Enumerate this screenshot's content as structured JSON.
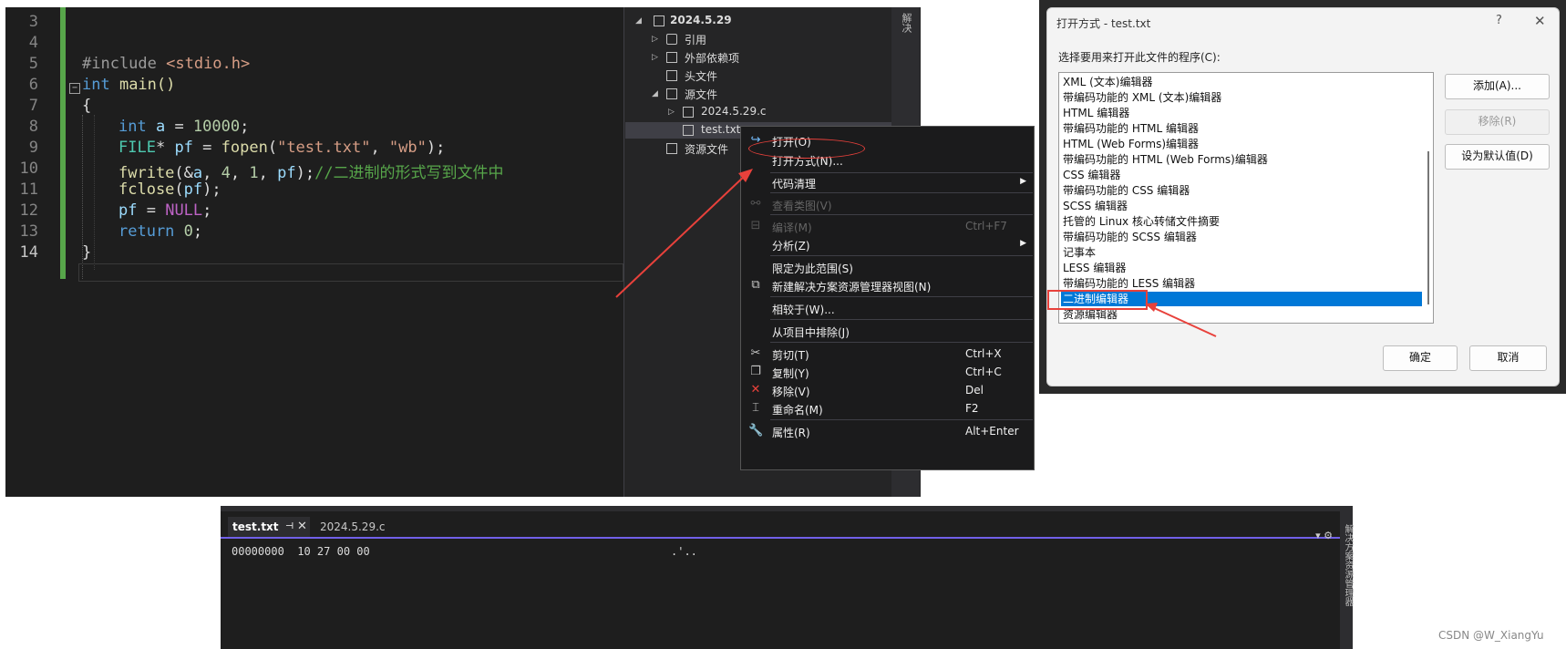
{
  "editor": {
    "line_numbers": [
      "3",
      "4",
      "5",
      "6",
      "7",
      "8",
      "9",
      "10",
      "11",
      "12",
      "13",
      "14"
    ],
    "fold_marker": "−",
    "code": {
      "include_kw": "#include",
      "include_hdr": " <stdio.h>",
      "int_kw": "int",
      "main_rest": " main()",
      "brace_open": "{",
      "l8_type": "int",
      "l8_var": " a",
      "l8_eq": " = ",
      "l8_num": "10000",
      "l8_semi": ";",
      "l9_type": "FILE",
      "l9_star": "*",
      "l9_var": " pf",
      "l9_eq": " = ",
      "l9_fn": "fopen",
      "l9_p1": "(",
      "l9_s1": "\"test.txt\"",
      "l9_c": ", ",
      "l9_s2": "\"wb\"",
      "l9_p2": ");",
      "l10_fn": "fwrite",
      "l10_p1": "(&",
      "l10_a": "a",
      "l10_c1": ", ",
      "l10_n1": "4",
      "l10_c2": ", ",
      "l10_n2": "1",
      "l10_c3": ", ",
      "l10_pf": "pf",
      "l10_p2": ");",
      "l10_comment": "//二进制的形式写到文件中",
      "l11_fn": "fclose",
      "l11_p1": "(",
      "l11_pf": "pf",
      "l11_p2": ");",
      "l12_pf": "pf",
      "l12_eq": " = ",
      "l12_null": "NULL",
      "l12_semi": ";",
      "l13_kw": "return",
      "l13_sp": " ",
      "l13_num": "0",
      "l13_semi": ";",
      "brace_close": "}"
    }
  },
  "explorer": {
    "items": {
      "project": "2024.5.29",
      "refs": "引用",
      "external": "外部依赖项",
      "headers": "头文件",
      "sources": "源文件",
      "c_file": "2024.5.29.c",
      "txt_file": "test.txt",
      "resources": "资源文件"
    },
    "strip_label": "解决"
  },
  "context_menu": {
    "open": {
      "label": "打开(O)"
    },
    "open_with": {
      "label": "打开方式(N)..."
    },
    "code_cleanup": {
      "label": "代码清理"
    },
    "view_class_diagram": {
      "label": "查看类图(V)"
    },
    "compile": {
      "label": "编译(M)",
      "shortcut": "Ctrl+F7"
    },
    "analyze": {
      "label": "分析(Z)"
    },
    "scope_to_this": {
      "label": "限定为此范围(S)"
    },
    "new_explorer_view": {
      "label": "新建解决方案资源管理器视图(N)"
    },
    "compare_with": {
      "label": "相较于(W)..."
    },
    "exclude_from_project": {
      "label": "从项目中排除(J)"
    },
    "cut": {
      "label": "剪切(T)",
      "shortcut": "Ctrl+X"
    },
    "copy": {
      "label": "复制(Y)",
      "shortcut": "Ctrl+C"
    },
    "remove": {
      "label": "移除(V)",
      "shortcut": "Del"
    },
    "rename": {
      "label": "重命名(M)",
      "shortcut": "F2"
    },
    "properties": {
      "label": "属性(R)",
      "shortcut": "Alt+Enter"
    }
  },
  "dialog": {
    "title": "打开方式 - test.txt",
    "help": "?",
    "close": "✕",
    "prompt": "选择要用来打开此文件的程序(C):",
    "programs": [
      "XML (文本)编辑器",
      "带编码功能的 XML (文本)编辑器",
      "HTML 编辑器",
      "带编码功能的 HTML 编辑器",
      "HTML (Web Forms)编辑器",
      "带编码功能的 HTML (Web Forms)编辑器",
      "CSS 编辑器",
      "带编码功能的 CSS 编辑器",
      "SCSS 编辑器",
      "托管的 Linux 核心转储文件摘要",
      "带编码功能的 SCSS 编辑器",
      "记事本",
      "LESS 编辑器",
      "带编码功能的 LESS 编辑器",
      "二进制编辑器",
      "资源编辑器"
    ],
    "selected_index": 14,
    "buttons": {
      "add": "添加(A)...",
      "remove": "移除(R)",
      "set_default": "设为默认值(D)",
      "ok": "确定",
      "cancel": "取消"
    }
  },
  "hex_editor": {
    "tabs": [
      {
        "label": "test.txt",
        "active": true
      },
      {
        "label": "2024.5.29.c",
        "active": false
      }
    ],
    "pin": "⊣",
    "close": "✕",
    "controls": "▾ ⚙",
    "rows": [
      {
        "offset": "00000000",
        "bytes": "10 27 00 00",
        "ascii": ".'.."
      }
    ],
    "side_label": "解决方案资源管理器"
  },
  "watermark": "CSDN @W_XiangYu",
  "colors": {
    "accent_red": "#e8413b",
    "selection_blue": "#0078d7",
    "tab_underline": "#7160e8",
    "change_bar": "#57a64a"
  }
}
